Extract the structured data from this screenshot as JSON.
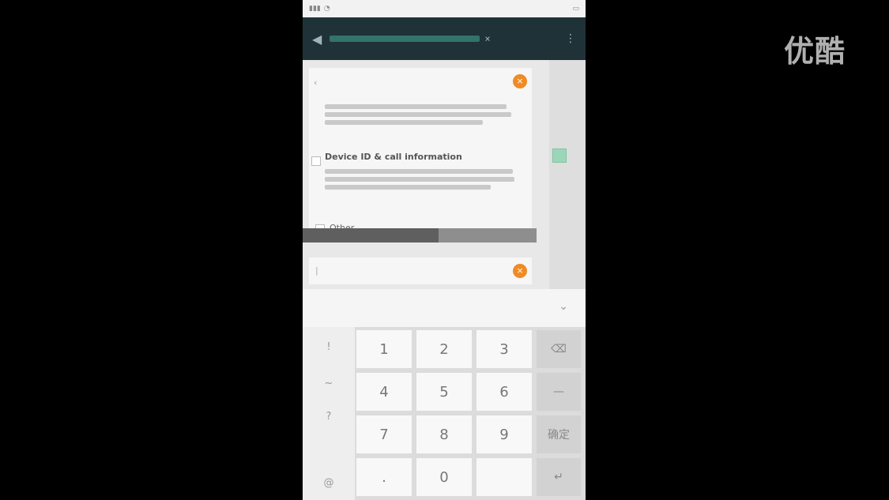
{
  "watermark": {
    "text": "优酷"
  },
  "statusbar": {
    "left_icons": [
      "signal-icon",
      "wifi-icon"
    ],
    "right_icons": [
      "battery-icon"
    ]
  },
  "appbar": {
    "back_icon": "back-icon",
    "clear_icon": "close-icon",
    "menu_icon": "more-icon"
  },
  "card": {
    "section_title": "Device ID & call information",
    "other_label": "Other"
  },
  "keyboard": {
    "symbols": [
      "!",
      "~",
      "?",
      "@"
    ],
    "rows": [
      [
        "1",
        "2",
        "3"
      ],
      [
        "4",
        "5",
        "6"
      ],
      [
        "7",
        "8",
        "9"
      ],
      [
        ".",
        "0",
        ""
      ]
    ],
    "function_keys": [
      "⌫",
      "—",
      "确定",
      "↵"
    ]
  }
}
